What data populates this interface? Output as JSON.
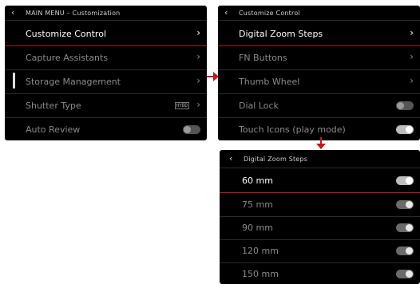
{
  "panel1": {
    "title": "MAIN MENU – Customization",
    "back": "‹",
    "items": [
      {
        "label": "Customize Control",
        "chevron": "›"
      },
      {
        "label": "Capture Assistants",
        "chevron": "›"
      },
      {
        "label": "Storage Management",
        "chevron": "›"
      },
      {
        "label": "Shutter Type",
        "badge": "HYBD",
        "chevron": "›"
      },
      {
        "label": "Auto Review",
        "toggle": "off"
      }
    ]
  },
  "panel2": {
    "title": "Customize Control",
    "back": "‹",
    "items": [
      {
        "label": "Digital Zoom Steps",
        "chevron": "›"
      },
      {
        "label": "FN Buttons",
        "chevron": "›"
      },
      {
        "label": "Thumb Wheel",
        "chevron": "›"
      },
      {
        "label": "Dial Lock",
        "toggle": "off"
      },
      {
        "label": "Touch Icons (play mode)",
        "toggle": "on"
      }
    ]
  },
  "panel3": {
    "title": "Digital Zoom Steps",
    "back": "‹",
    "items": [
      {
        "label": "60 mm",
        "toggle": "on"
      },
      {
        "label": "75 mm",
        "toggle": "on"
      },
      {
        "label": "90 mm",
        "toggle": "on"
      },
      {
        "label": "120 mm",
        "toggle": "on"
      },
      {
        "label": "150 mm",
        "toggle": "on"
      }
    ]
  },
  "colors": {
    "accent": "#c4161c",
    "panel_bg": "#000000",
    "text_active": "#ffffff",
    "text_inactive": "#8a8a8a"
  }
}
